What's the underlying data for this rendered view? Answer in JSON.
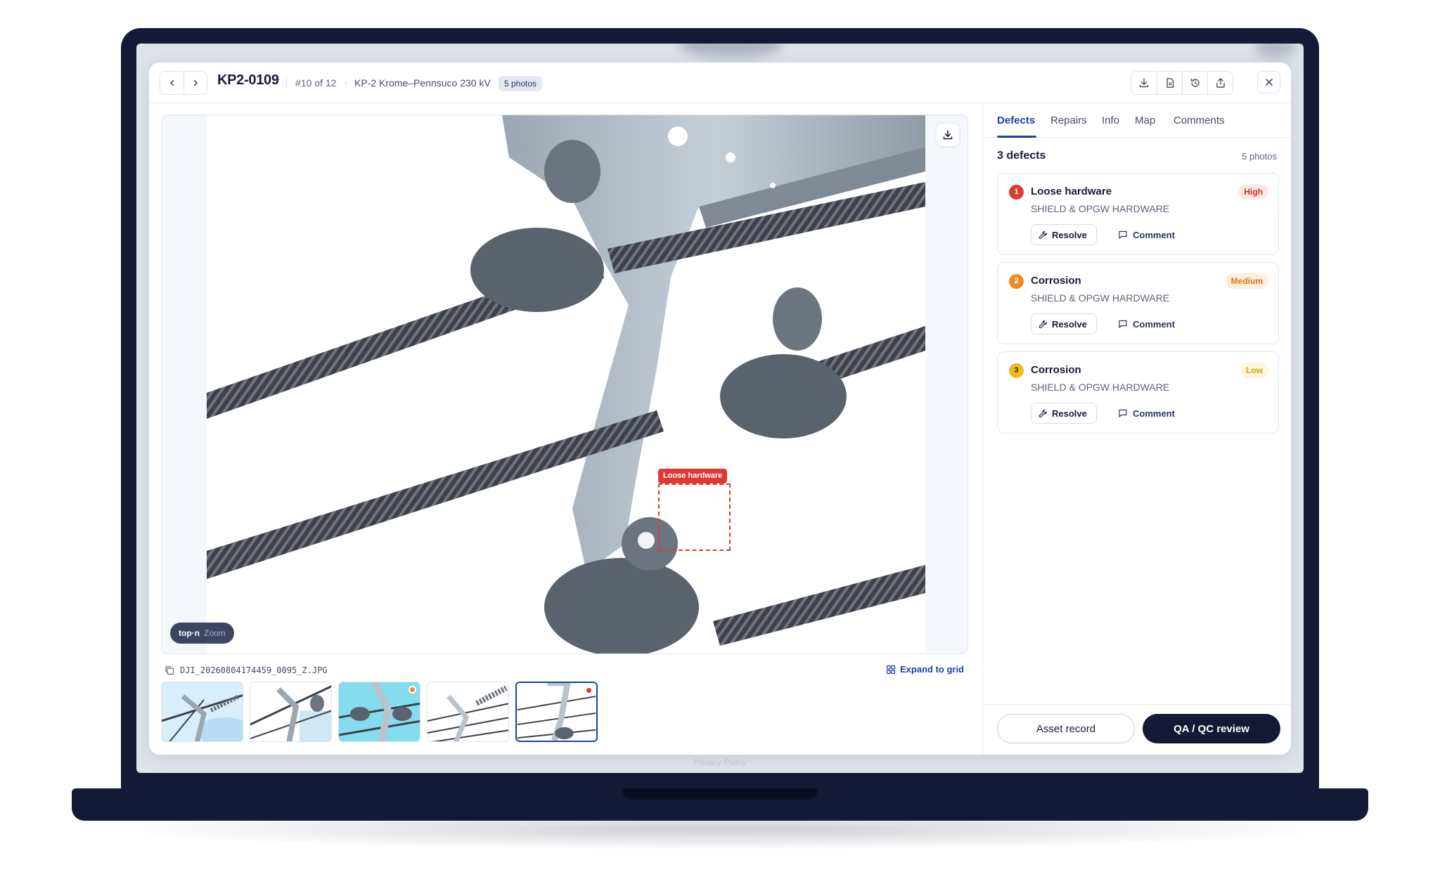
{
  "header": {
    "asset_id": "KP2-0109",
    "sequence": "#10 of 12",
    "separator": "·",
    "line_name": "KP-2 Krome–Pennsuco 230 kV",
    "photos_badge": "5 photos",
    "tools": [
      "download-icon",
      "document-icon",
      "history-icon",
      "share-icon"
    ],
    "close_icon": "close-icon"
  },
  "viewer": {
    "defect_label": "Loose hardware",
    "zoom_brand": "top·n",
    "zoom_mode": "Zoom",
    "filename": "DJI_20260804174459_0095_Z.JPG",
    "expand_label": "Expand to grid",
    "thumbnails": [
      {
        "style": "sky",
        "marker": null
      },
      {
        "style": "sky",
        "marker": null
      },
      {
        "style": "cyan",
        "marker": "#f08a24"
      },
      {
        "style": "white",
        "marker": null
      },
      {
        "style": "white",
        "marker": "#dc3a34",
        "active": true
      }
    ]
  },
  "sidebar": {
    "tabs": [
      "Defects",
      "Repairs",
      "Info",
      "Map",
      "Comments"
    ],
    "active_tab": "Defects",
    "defects_count": "3 defects",
    "photos_count": "5 photos",
    "defects": [
      {
        "num": "1",
        "title": "Loose hardware",
        "category": "SHIELD & OPGW HARDWARE",
        "severity": "High",
        "num_color": "#dc3a34",
        "sev_bg": "#fde7e7",
        "sev_fg": "#c9302c"
      },
      {
        "num": "2",
        "title": "Corrosion",
        "category": "SHIELD & OPGW HARDWARE",
        "severity": "Medium",
        "num_color": "#f08a24",
        "sev_bg": "#fdeedd",
        "sev_fg": "#d97512"
      },
      {
        "num": "3",
        "title": "Corrosion",
        "category": "SHIELD & OPGW HARDWARE",
        "severity": "Low",
        "num_color": "#f2b81f",
        "sev_bg": "#fdf6dc",
        "sev_fg": "#d9a30a"
      }
    ],
    "resolve_label": "Resolve",
    "comment_label": "Comment"
  },
  "footer": {
    "asset_record_label": "Asset record",
    "qa_label": "QA / QC review"
  },
  "privacy": "Privacy Policy"
}
